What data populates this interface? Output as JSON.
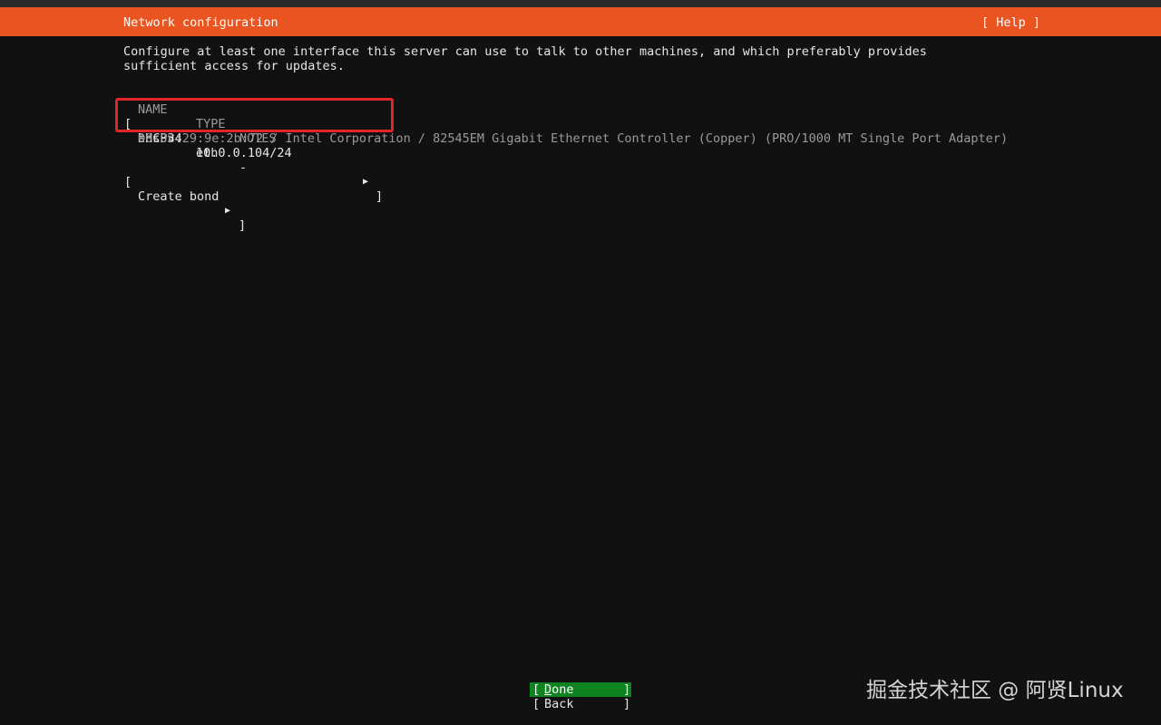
{
  "header": {
    "title": "Network configuration",
    "help_label": "[ Help ]"
  },
  "intro": "Configure at least one interface this server can use to talk to other machines, and which preferably provides sufficient access for updates.",
  "table": {
    "columns": [
      "NAME",
      "TYPE",
      "NOTES"
    ],
    "interfaces": [
      {
        "bracket_open": "[",
        "name": "ens33",
        "type": "eth",
        "notes": "-",
        "arrow": "▶",
        "bracket_close": "]",
        "addr_method": "DHCPv4",
        "address": "10.0.0.104/24",
        "hw_info": "00:0c:29:9e:2b:72 / Intel Corporation / 82545EM Gigabit Ethernet Controller (Copper) (PRO/1000 MT Single Port Adapter)"
      }
    ]
  },
  "create_bond": {
    "open": "[",
    "label": "Create bond",
    "arrow": "▶",
    "close": "]"
  },
  "buttons": {
    "done": {
      "open": "[",
      "accel": "D",
      "rest": "one",
      "close": "]"
    },
    "back": {
      "open": "[",
      "label": "Back",
      "close": "]"
    }
  },
  "watermark": "掘金技术社区 @ 阿贤Linux",
  "colors": {
    "header_bg": "#e95420",
    "done_bg": "#0e8420",
    "highlight": "#e3242b",
    "background": "#111111"
  }
}
